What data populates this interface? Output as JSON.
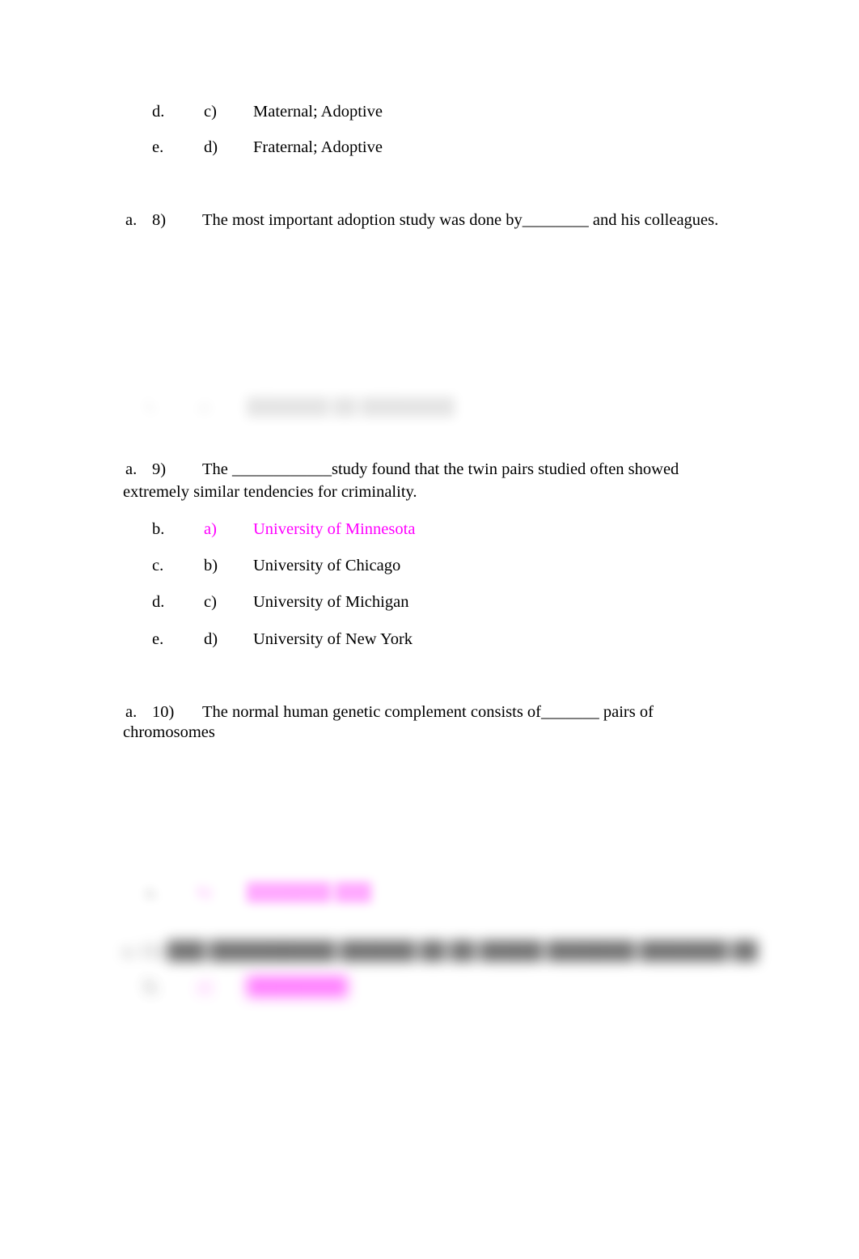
{
  "document": {
    "background_color": "#ffffff",
    "text_color": "#000000",
    "highlight_color": "#ff00ff"
  },
  "questions": [
    {
      "id": "q7-tail",
      "options": [
        {
          "marker": "d.",
          "letter": "c)",
          "text": "Maternal; Adoptive",
          "highlighted": false
        },
        {
          "marker": "e.",
          "letter": "d)",
          "text": "Fraternal; Adoptive",
          "highlighted": false
        }
      ]
    },
    {
      "id": "q8",
      "marker": "a.",
      "number": "8)",
      "text": "The most important adoption study was done by________ and his colleagues.",
      "options": []
    },
    {
      "id": "q9",
      "marker": "a.",
      "number": "9)",
      "text": "The ____________study found that the twin pairs studied often showed",
      "text_line2": "extremely similar tendencies for criminality.",
      "options": [
        {
          "marker": "b.",
          "letter": "a)",
          "text": "University of Minnesota",
          "highlighted": true
        },
        {
          "marker": "c.",
          "letter": "b)",
          "text": " University of Chicago",
          "highlighted": false
        },
        {
          "marker": "d.",
          "letter": "c)",
          "text": "University of Michigan",
          "highlighted": false
        },
        {
          "marker": "e.",
          "letter": "d)",
          "text": " University of New York",
          "highlighted": false
        }
      ]
    },
    {
      "id": "q10",
      "marker": "a.",
      "number": "10)",
      "text": "The normal human genetic complement consists of_______ pairs of",
      "text_line2": "chromosomes",
      "options": []
    }
  ],
  "redacted": {
    "note": "illegible blurred content",
    "block_1": {
      "marker": "b.",
      "letter": "a)",
      "text": "███████ ██ ████████"
    },
    "block_2": {
      "marker": "a.",
      "letter": "b)",
      "text": "███████ ███"
    },
    "block_3": {
      "line": "a.  11)   ███ ██████████ ██████ ██ ██ █████ ███████ ███████ ██"
    },
    "block_4": {
      "marker": "b.",
      "letter": "a)",
      "text": "████████"
    }
  }
}
